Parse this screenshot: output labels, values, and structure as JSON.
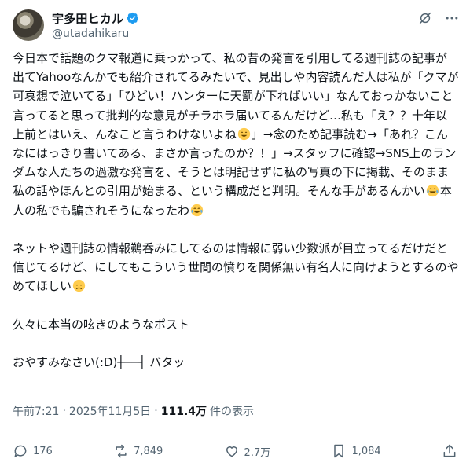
{
  "user": {
    "display_name": "宇多田ヒカル",
    "handle": "@utadahikaru"
  },
  "header_icons": [
    "verified-badge-icon",
    "grok-icon",
    "more-icon"
  ],
  "colors": {
    "verified": "#1d9bf0",
    "text": "#0f1419",
    "secondary": "#536471",
    "divider": "#eff3f4"
  },
  "post": {
    "p1_a": "今日本で話題のクマ報道に乗っかって、私の昔の発言を引用してる週刊誌の記事が出てYahooなんかでも紹介されてるみたいで、見出しや内容読んだ人は私が「クマが可哀想で泣いてる」「ひどい！ハンターに天罰が下ればいい」なんておっかないこと言ってると思って批判的な意見がチラホラ届いてるんだけど…私も「え？？十年以上前とはいえ、んなこと言うわけないよね",
    "p1_b": "」→念のため記事読む→「あれ？こんなにはっきり書いてある、まさか言ったのか？！」→スタッフに確認→SNS上のランダムな人たちの過激な発言を、そうとは明記せずに私の写真の下に掲載、そのまま私の話やほんとの引用が始まる、という構成だと判明。そんな手があるんかい",
    "p1_c": "本人の私でも騙されそうになったわ",
    "p2_a": "ネットや週刊誌の情報鵜呑みにしてるのは情報に弱い少数派が目立ってるだけだと信じてるけど、にしてもこういう世間の憤りを関係無い有名人に向けようとするのやめてほしい",
    "p3": "久々に本当の呟きのようなポスト",
    "p4": "おやすみなさい(:D)┼──┤ バタッ"
  },
  "emoji_names": [
    "sweat-smile-emoji",
    "joy-emoji",
    "joy-emoji",
    "disappointed-emoji"
  ],
  "meta": {
    "time": "午前7:21",
    "separator": "·",
    "date": "2025年11月5日",
    "separator2": "·",
    "views": "111.4万",
    "views_label": "件の表示"
  },
  "actions": {
    "replies": "176",
    "reposts": "7,849",
    "likes": "2.7万",
    "bookmarks": "1,084"
  }
}
